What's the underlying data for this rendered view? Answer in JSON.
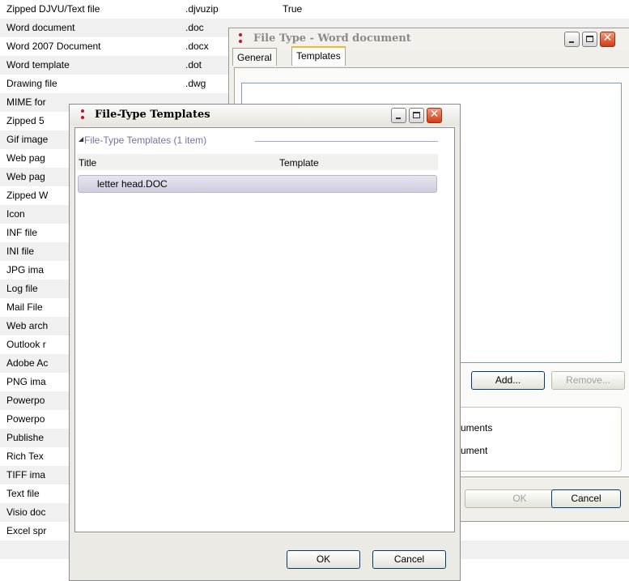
{
  "background_list": {
    "rows": [
      {
        "name": "Zipped DJVU/Text file",
        "ext": ".djvuzip",
        "flag": "True"
      },
      {
        "name": "Word document",
        "ext": ".doc",
        "flag": ""
      },
      {
        "name": "Word 2007 Document",
        "ext": ".docx",
        "flag": ""
      },
      {
        "name": "Word template",
        "ext": ".dot",
        "flag": ""
      },
      {
        "name": "Drawing file",
        "ext": ".dwg",
        "flag": ""
      },
      {
        "name": "MIME for",
        "ext": "",
        "flag": ""
      },
      {
        "name": "Zipped 5",
        "ext": "",
        "flag": ""
      },
      {
        "name": "Gif image",
        "ext": "",
        "flag": ""
      },
      {
        "name": "Web pag",
        "ext": "",
        "flag": ""
      },
      {
        "name": "Web pag",
        "ext": "",
        "flag": ""
      },
      {
        "name": "Zipped W",
        "ext": "",
        "flag": ""
      },
      {
        "name": "Icon",
        "ext": "",
        "flag": ""
      },
      {
        "name": "INF file",
        "ext": "",
        "flag": ""
      },
      {
        "name": "INI file",
        "ext": "",
        "flag": ""
      },
      {
        "name": "JPG ima",
        "ext": "",
        "flag": ""
      },
      {
        "name": "Log file",
        "ext": "",
        "flag": ""
      },
      {
        "name": "Mail File",
        "ext": "",
        "flag": ""
      },
      {
        "name": "Web arch",
        "ext": "",
        "flag": ""
      },
      {
        "name": "Outlook r",
        "ext": "",
        "flag": ""
      },
      {
        "name": "Adobe Ac",
        "ext": "",
        "flag": ""
      },
      {
        "name": "PNG ima",
        "ext": "",
        "flag": ""
      },
      {
        "name": "Powerpo",
        "ext": "",
        "flag": ""
      },
      {
        "name": "Powerpo",
        "ext": "",
        "flag": ""
      },
      {
        "name": "Publishe",
        "ext": "",
        "flag": ""
      },
      {
        "name": "Rich Tex",
        "ext": "",
        "flag": ""
      },
      {
        "name": "TIFF ima",
        "ext": "",
        "flag": ""
      },
      {
        "name": "Text file",
        "ext": "",
        "flag": ""
      },
      {
        "name": "Visio doc",
        "ext": "",
        "flag": ""
      },
      {
        "name": "Excel spr",
        "ext": "",
        "flag": ""
      },
      {
        "name": "",
        "ext": "",
        "flag": ""
      },
      {
        "name": "",
        "ext": "",
        "flag": ""
      }
    ]
  },
  "file_type_dialog": {
    "title": "File Type - Word document",
    "tabs": [
      {
        "label": "General"
      },
      {
        "label": "Templates"
      }
    ],
    "add_button": "Add...",
    "remove_button": "Remove...",
    "option1_fragment": "uments",
    "option2_fragment": "ument",
    "ok_button": "OK",
    "cancel_button": "Cancel"
  },
  "templates_dialog": {
    "title": "File-Type Templates",
    "group_label": "File-Type Templates (1 item)",
    "columns": {
      "title": "Title",
      "template": "Template"
    },
    "rows": [
      {
        "title": "letter head.DOC",
        "template": ""
      }
    ],
    "ok_button": "OK",
    "cancel_button": "Cancel"
  },
  "icons": {
    "app": "app-dots-icon",
    "minimize": "minimize-icon",
    "maximize": "maximize-icon",
    "close": "close-icon",
    "collapse": "collapse-triangle-icon"
  },
  "colors": {
    "app_icon": "#c8102e",
    "active_tab_accent": "#f4b52f",
    "close_button": "#d23b16"
  }
}
